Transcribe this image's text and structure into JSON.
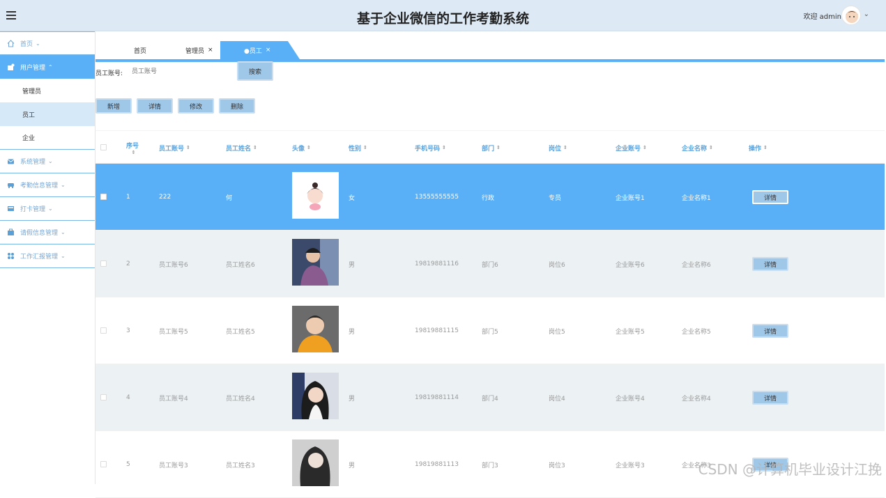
{
  "header": {
    "title": "基于企业微信的工作考勤系统",
    "welcome": "欢迎 admin"
  },
  "sidebar": {
    "items": [
      {
        "label": "首页",
        "icon": "home-icon"
      },
      {
        "label": "用户管理",
        "icon": "user-icon"
      },
      {
        "label": "系统管理",
        "icon": "mail-icon"
      },
      {
        "label": "考勤信息管理",
        "icon": "car-icon"
      },
      {
        "label": "打卡管理",
        "icon": "card-icon"
      },
      {
        "label": "请假信息管理",
        "icon": "briefcase-icon"
      },
      {
        "label": "工作汇报管理",
        "icon": "grid-icon"
      }
    ],
    "sub_items": [
      "管理员",
      "员工",
      "企业"
    ]
  },
  "tabs": [
    {
      "label": "首页"
    },
    {
      "label": "管理员"
    },
    {
      "label": "●员工"
    }
  ],
  "search": {
    "label": "员工账号:",
    "placeholder": "员工账号",
    "button": "搜索"
  },
  "actions": {
    "add": "新增",
    "detail": "详情",
    "edit": "修改",
    "delete": "删除"
  },
  "table": {
    "headers": [
      "序号",
      "员工账号",
      "员工姓名",
      "头像",
      "性别",
      "手机号码",
      "部门",
      "岗位",
      "企业账号",
      "企业名称",
      "操作"
    ],
    "rows": [
      {
        "no": "1",
        "account": "222",
        "name": "何",
        "gender": "女",
        "phone": "13555555555",
        "dept": "行政",
        "post": "专员",
        "corp_account": "企业账号1",
        "corp_name": "企业名称1",
        "op": "详情"
      },
      {
        "no": "2",
        "account": "员工账号6",
        "name": "员工姓名6",
        "gender": "男",
        "phone": "19819881116",
        "dept": "部门6",
        "post": "岗位6",
        "corp_account": "企业账号6",
        "corp_name": "企业名称6",
        "op": "详情"
      },
      {
        "no": "3",
        "account": "员工账号5",
        "name": "员工姓名5",
        "gender": "男",
        "phone": "19819881115",
        "dept": "部门5",
        "post": "岗位5",
        "corp_account": "企业账号5",
        "corp_name": "企业名称5",
        "op": "详情"
      },
      {
        "no": "4",
        "account": "员工账号4",
        "name": "员工姓名4",
        "gender": "男",
        "phone": "19819881114",
        "dept": "部门4",
        "post": "岗位4",
        "corp_account": "企业账号4",
        "corp_name": "企业名称4",
        "op": "详情"
      },
      {
        "no": "5",
        "account": "员工账号3",
        "name": "员工姓名3",
        "gender": "男",
        "phone": "19819881113",
        "dept": "部门3",
        "post": "岗位3",
        "corp_account": "企业账号3",
        "corp_name": "企业名称3",
        "op": "详情"
      }
    ]
  },
  "watermark": "CSDN @计算机毕业设计江挽",
  "colors": {
    "accent": "#5ab0f6",
    "header_bg": "#dde9f5",
    "button": "#9fc7e8"
  }
}
